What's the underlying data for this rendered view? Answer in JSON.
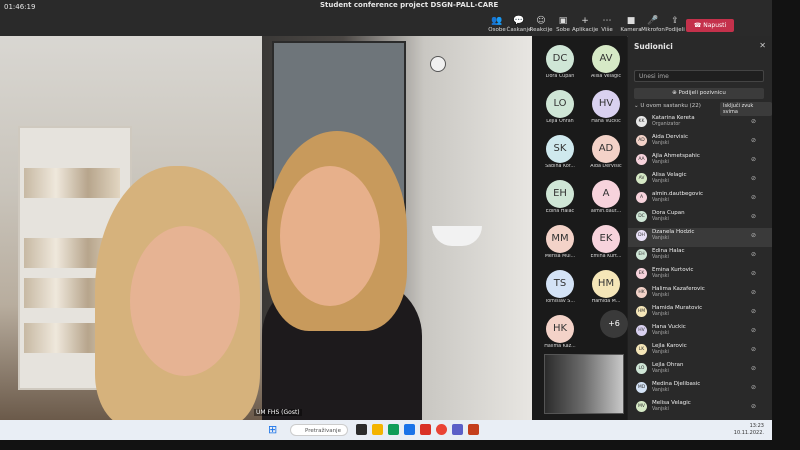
{
  "window": {
    "timer": "01:46:19",
    "title": "Student conference project DSGN-PALL-CARE"
  },
  "toolbar": {
    "buttons": [
      {
        "icon": "chat-icon",
        "label": "Osobe"
      },
      {
        "icon": "chat-bubble-icon",
        "label": "Ćaskanje"
      },
      {
        "icon": "reactions-icon",
        "label": "Reakcije"
      },
      {
        "icon": "rooms-icon",
        "label": "Sobe"
      },
      {
        "icon": "apps-icon",
        "label": "Aplikacije"
      },
      {
        "icon": "more-icon",
        "label": "Više"
      },
      {
        "icon": "camera-icon",
        "label": "Kamera"
      },
      {
        "icon": "mic-icon",
        "label": "Mikrofon"
      },
      {
        "icon": "share-icon",
        "label": "Podijeli"
      }
    ],
    "leave_label": "Napusti",
    "leave_color": "#c4314b"
  },
  "video": {
    "right_label": "UM FHS (Gost)"
  },
  "gallery": [
    {
      "initials": "DC",
      "name": "Dora Cupan",
      "color": "#cfe6d6"
    },
    {
      "initials": "AV",
      "name": "Alisa Velagic",
      "color": "#d6e9c6"
    },
    {
      "initials": "LO",
      "name": "Lejla Ohran",
      "color": "#cfe6d6"
    },
    {
      "initials": "HV",
      "name": "Hana Vuckic",
      "color": "#d9d1f0"
    },
    {
      "initials": "SK",
      "name": "Sabina Kor...",
      "color": "#cfe9ee"
    },
    {
      "initials": "AD",
      "name": "Aida Dervisic",
      "color": "#f3d2c8"
    },
    {
      "initials": "EH",
      "name": "Edina Halac",
      "color": "#cfe6d6"
    },
    {
      "initials": "A",
      "name": "almin.daut...",
      "color": "#f7d3dc"
    },
    {
      "initials": "MM",
      "name": "Merisa Mul...",
      "color": "#f3d2c8"
    },
    {
      "initials": "EK",
      "name": "Emina Kurt...",
      "color": "#f7d3dc"
    },
    {
      "initials": "TS",
      "name": "Tomislav S...",
      "color": "#d4e3f6"
    },
    {
      "initials": "HM",
      "name": "Hamida M...",
      "color": "#f5e6b8"
    },
    {
      "initials": "HK",
      "name": "Halima Kaz...",
      "color": "#f3d2c8"
    }
  ],
  "gallery_more": "+6",
  "panel": {
    "title": "Sudionici",
    "search_placeholder": "Unesi ime",
    "share_label": "Podijeli pozivnicu",
    "section_label": "U ovom sastanku (22)",
    "mute_all": "Isključi zvuk svima",
    "participants": [
      {
        "initials": "KK",
        "name": "Katarina Kereta",
        "role": "Organizator",
        "color": "#e8e8e8"
      },
      {
        "initials": "AD",
        "name": "Aida Dervisic",
        "role": "Vanjski",
        "color": "#f3d2c8"
      },
      {
        "initials": "AA",
        "name": "Ajla Ahmetspahic",
        "role": "Vanjski",
        "color": "#f7d3dc"
      },
      {
        "initials": "AV",
        "name": "Alisa Velagic",
        "role": "Vanjski",
        "color": "#d6e9c6"
      },
      {
        "initials": "A",
        "name": "almin.dautbegovic",
        "role": "Vanjski",
        "color": "#f7d3dc"
      },
      {
        "initials": "DC",
        "name": "Dora Cupan",
        "role": "Vanjski",
        "color": "#cfe6d6"
      },
      {
        "initials": "DH",
        "name": "Dzanela Hodzic",
        "role": "Vanjski",
        "color": "#e8e0f6"
      },
      {
        "initials": "EH",
        "name": "Edina Halac",
        "role": "Vanjski",
        "color": "#cfe6d6"
      },
      {
        "initials": "EK",
        "name": "Emina Kurtovic",
        "role": "Vanjski",
        "color": "#f7d3dc"
      },
      {
        "initials": "HK",
        "name": "Halima Kazaferovic",
        "role": "Vanjski",
        "color": "#f3d2c8"
      },
      {
        "initials": "HM",
        "name": "Hamida Muratovic",
        "role": "Vanjski",
        "color": "#f5e6b8"
      },
      {
        "initials": "HV",
        "name": "Hana Vuckic",
        "role": "Vanjski",
        "color": "#d9d1f0"
      },
      {
        "initials": "LK",
        "name": "Lejla Karovic",
        "role": "Vanjski",
        "color": "#f5e6b8"
      },
      {
        "initials": "LO",
        "name": "Lejla Ohran",
        "role": "Vanjski",
        "color": "#cfe6d6"
      },
      {
        "initials": "MD",
        "name": "Medina Djelibasic",
        "role": "Vanjski",
        "color": "#d4e3f6"
      },
      {
        "initials": "MV",
        "name": "Melisa Velagic",
        "role": "Vanjski",
        "color": "#d6e9c6"
      }
    ]
  },
  "taskbar": {
    "search_label": "Pretraživanje",
    "time": "13:23",
    "date": "10.11.2022."
  }
}
